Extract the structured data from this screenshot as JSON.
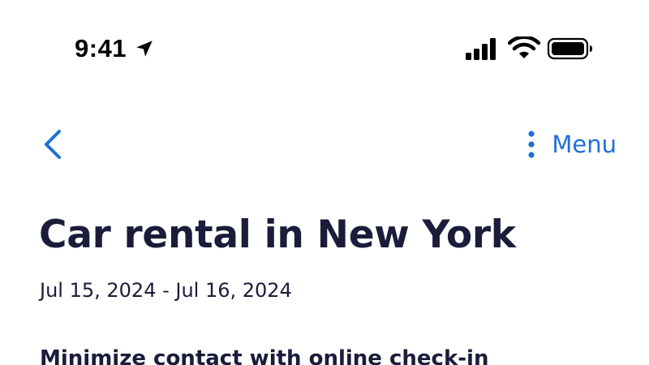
{
  "status_bar": {
    "time": "9:41",
    "icons": [
      "location-arrow-icon",
      "cellular-signal-icon",
      "wifi-icon",
      "battery-icon"
    ]
  },
  "nav": {
    "back_icon": "chevron-left-icon",
    "menu_icon": "kebab-menu-icon",
    "menu_label": "Menu",
    "accent_color": "#1f6fd9"
  },
  "header": {
    "title": "Car rental in New York",
    "date_range": "Jul 15, 2024 - Jul 16, 2024"
  },
  "content": {
    "section_heading": "Minimize contact with online check-in"
  },
  "colors": {
    "text_primary": "#1b1c3a",
    "accent": "#1f6fd9",
    "background": "#ffffff"
  }
}
